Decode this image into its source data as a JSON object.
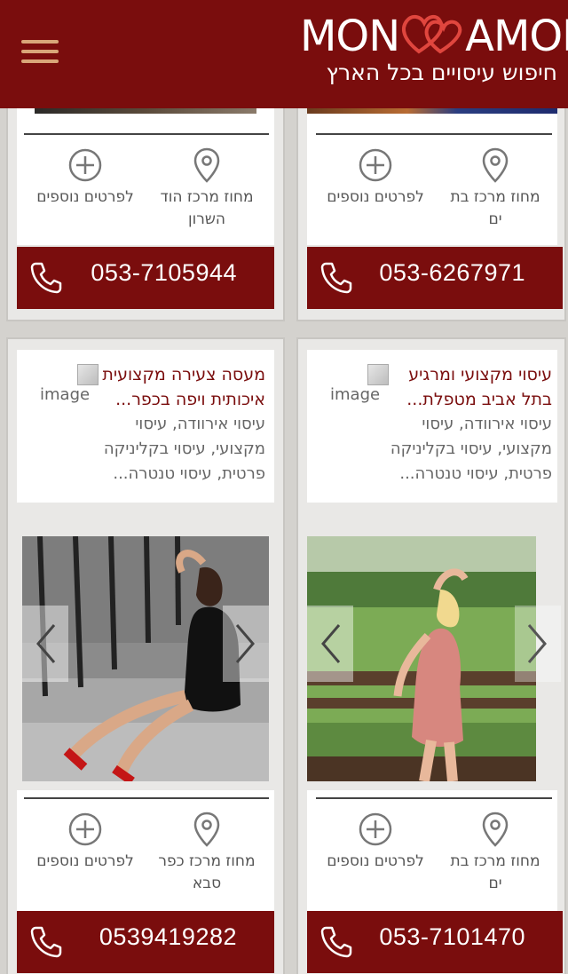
{
  "header": {
    "logo_left": "MON",
    "logo_right": "AMOR",
    "tagline": "חיפוש עיסויים בכל הארץ",
    "brand_color": "#7a0d0d",
    "menu_icon": "hamburger-menu-icon"
  },
  "cards": [
    {
      "location": "מחוז מרכז בת ים",
      "more": "לפרטים נוספים",
      "phone": "053-6267971"
    },
    {
      "location": "מחוז מרכז הוד השרון",
      "more": "לפרטים נוספים",
      "phone": "053-7105944"
    },
    {
      "title": "עיסוי מקצועי ומרגיע בתל אביב מטפלת...",
      "image_alt": "image",
      "description": "עיסוי אירוודה, עיסוי מקצועי, עיסוי בקליניקה פרטית, עיסוי טנטרה...",
      "location": "מחוז מרכז בת ים",
      "more": "לפרטים נוספים",
      "phone": "053-7101470"
    },
    {
      "title": "מעסה צעירה מקצועית איכותית ויפה בכפר...",
      "image_alt": "image",
      "description": "עיסוי אירוודה, עיסוי מקצועי, עיסוי בקליניקה פרטית, עיסוי טנטרה...",
      "location": "מחוז מרכז כפר סבא",
      "more": "לפרטים נוספים",
      "phone": "0539419282"
    }
  ]
}
